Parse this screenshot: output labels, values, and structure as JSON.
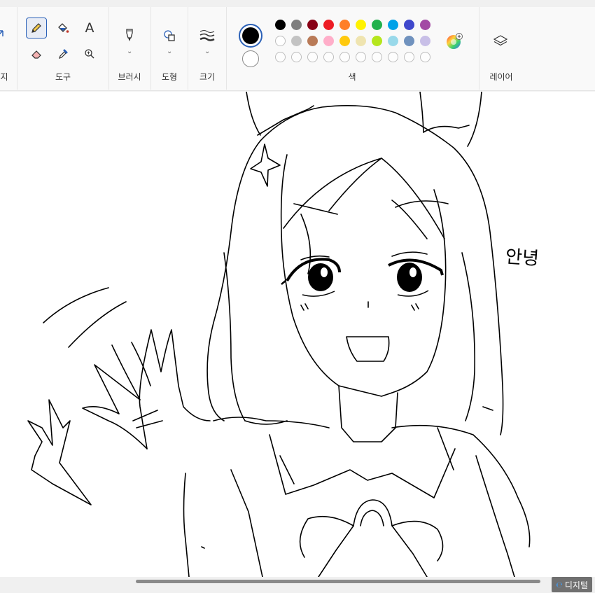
{
  "ribbon": {
    "groups": {
      "image_label": "지",
      "tools_label": "도구",
      "brush_label": "브러시",
      "shapes_label": "도형",
      "size_label": "크기",
      "colors_label": "색",
      "layers_label": "레이어"
    },
    "text_tool_glyph": "A"
  },
  "colors": {
    "primary": "#000000",
    "secondary": "#ffffff",
    "row1": [
      "#000000",
      "#7f7f7f",
      "#880015",
      "#ed1c24",
      "#ff7f27",
      "#fff200",
      "#22b14c",
      "#00a2e8",
      "#3f48cc",
      "#a349a4"
    ],
    "row2": [
      "#ffffff",
      "#c3c3c3",
      "#b97a57",
      "#ffaec9",
      "#ffc90e",
      "#efe4b0",
      "#b5e61d",
      "#99d9ea",
      "#7092be",
      "#c8bfe7"
    ],
    "row3_count": 10,
    "accent": "#2b61b8"
  },
  "canvas": {
    "handwritten_text": "안녕"
  },
  "watermark": {
    "text": "디지털"
  }
}
